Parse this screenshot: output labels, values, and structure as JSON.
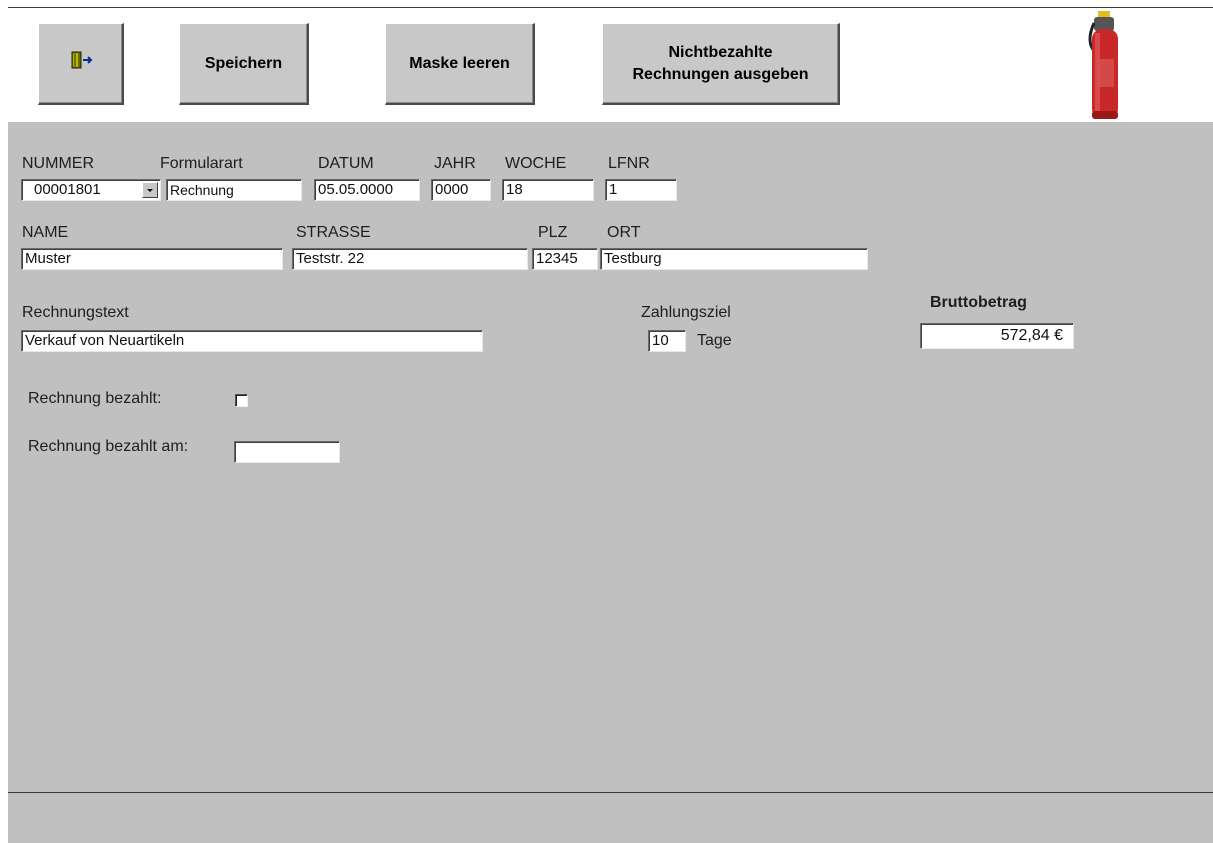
{
  "toolbar": {
    "exit_icon": "exit-door-icon",
    "save_label": "Speichern",
    "clear_label": "Maske leeren",
    "unpaid_label_line1": "Nichtbezahlte",
    "unpaid_label_line2": "Rechnungen ausgeben",
    "logo_icon": "fire-extinguisher-icon"
  },
  "form": {
    "nummer": {
      "label": "NUMMER",
      "value": "00001801"
    },
    "formularart": {
      "label": "Formularart",
      "value": "Rechnung"
    },
    "datum": {
      "label": "DATUM",
      "value": "05.05.0000"
    },
    "jahr": {
      "label": "JAHR",
      "value": "0000"
    },
    "woche": {
      "label": "WOCHE",
      "value": "18"
    },
    "lfnr": {
      "label": "LFNR",
      "value": "1"
    },
    "name": {
      "label": "NAME",
      "value": "Muster"
    },
    "strasse": {
      "label": "STRASSE",
      "value": "Teststr. 22"
    },
    "plz": {
      "label": "PLZ",
      "value": "12345"
    },
    "ort": {
      "label": "ORT",
      "value": "Testburg"
    },
    "rechnungstext": {
      "label": "Rechnungstext",
      "value": "Verkauf von Neuartikeln"
    },
    "zahlungsziel": {
      "label": "Zahlungsziel",
      "value": "10",
      "unit": "Tage"
    },
    "bruttobetrag": {
      "label": "Bruttobetrag",
      "value": "572,84 €"
    },
    "bezahlt": {
      "label": "Rechnung bezahlt:",
      "checked": false
    },
    "bezahlt_am": {
      "label": "Rechnung bezahlt am:",
      "value": ""
    }
  },
  "colors": {
    "panel": "#c0c0c0",
    "button": "#c8c8c8",
    "extinguisher": "#c8282a"
  }
}
